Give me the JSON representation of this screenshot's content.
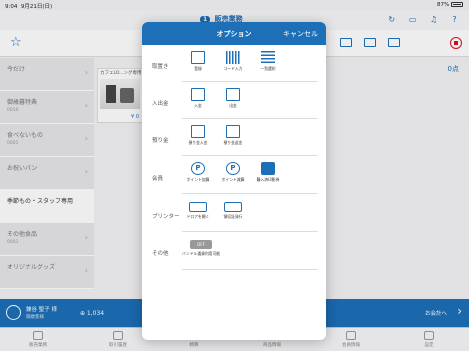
{
  "status_bar": {
    "time": "9:04",
    "date": "9月21日(日)",
    "battery": "87%"
  },
  "nav": {
    "badge": "1",
    "title": "販売業務"
  },
  "categories": [
    {
      "name": "今だけ",
      "code": ""
    },
    {
      "name": "御歳暮特典",
      "code": "0010"
    },
    {
      "name": "食べないもの",
      "code": "0001"
    },
    {
      "name": "お祝いパン",
      "code": ""
    },
    {
      "name": "季節もの・スタッフ専用",
      "code": ""
    },
    {
      "name": "その他食品",
      "code": "0001"
    },
    {
      "name": "オリジナルグッズ",
      "code": ""
    }
  ],
  "product": {
    "label": "カフェLO...ング専用",
    "price": "¥ 0"
  },
  "total": "0点",
  "customer": {
    "name": "鎌谷 聖子 様",
    "sub": "御歳客様",
    "points": "⊕ 1,034",
    "checkout": "お会計へ"
  },
  "tabs": [
    "販売業務",
    "取引履歴",
    "精算",
    "商品情報",
    "会員情報",
    "設定"
  ],
  "modal": {
    "title": "オプション",
    "cancel": "キャンセル",
    "sections": [
      {
        "label": "取置き",
        "options": [
          {
            "label": "登録",
            "icon": "register-icon"
          },
          {
            "label": "コード入力",
            "icon": "barcode-icon"
          },
          {
            "label": "一覧選択",
            "icon": "list-icon"
          }
        ]
      },
      {
        "label": "入出金",
        "options": [
          {
            "label": "入金",
            "icon": "deposit-icon"
          },
          {
            "label": "出金",
            "icon": "withdraw-icon"
          }
        ]
      },
      {
        "label": "預り金",
        "options": [
          {
            "label": "預り金入金",
            "icon": "deposit-icon"
          },
          {
            "label": "預り金返金",
            "icon": "refund-icon"
          }
        ]
      },
      {
        "label": "会員",
        "options": [
          {
            "label": "ポイント加算",
            "icon": "point-add-icon"
          },
          {
            "label": "ポイント減算",
            "icon": "point-subtract-icon"
          },
          {
            "label": "購入済印影券",
            "icon": "ticket-icon"
          }
        ]
      },
      {
        "label": "プリンター",
        "options": [
          {
            "label": "ドロアを開く",
            "icon": "drawer-icon"
          },
          {
            "label": "領収証発行",
            "icon": "receipt-icon"
          }
        ]
      },
      {
        "label": "その他",
        "options": [
          {
            "label": "バンドル通貨利用可能",
            "icon": "coupon-icon"
          }
        ]
      }
    ]
  }
}
